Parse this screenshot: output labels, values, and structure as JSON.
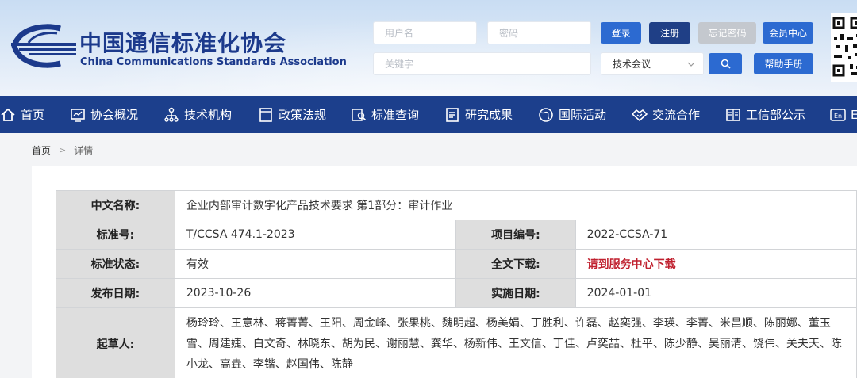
{
  "header": {
    "org_name_cn": "中国通信标准化协会",
    "org_name_en": "China Communications Standards Association",
    "username_placeholder": "用户名",
    "password_placeholder": "密码",
    "keyword_placeholder": "关键字",
    "login_label": "登录",
    "register_label": "注册",
    "forgot_label": "忘记密码",
    "member_center_label": "会员中心",
    "search_category": "技术会议",
    "help_label": "帮助手册"
  },
  "nav": {
    "items": [
      "首页",
      "协会概况",
      "技术机构",
      "政策法规",
      "标准查询",
      "研究成果",
      "国际活动",
      "交流合作",
      "工信部公示",
      "En"
    ]
  },
  "breadcrumb": {
    "home": "首页",
    "current": "详情"
  },
  "detail": {
    "cn_name_label": "中文名称:",
    "cn_name": "企业内部审计数字化产品技术要求 第1部分：审计作业",
    "std_no_label": "标准号:",
    "std_no": "T/CCSA 474.1-2023",
    "project_no_label": "项目编号:",
    "project_no": "2022-CCSA-71",
    "status_label": "标准状态:",
    "status": "有效",
    "download_label": "全文下载:",
    "download_link": "请到服务中心下载",
    "publish_label": "发布日期:",
    "publish_date": "2023-10-26",
    "impl_label": "实施日期:",
    "impl_date": "2024-01-01",
    "drafters_label": "起草人:",
    "drafters": "杨玲玲、王意林、蒋菁菁、王阳、周金峰、张果桃、魏明超、杨美娟、丁胜利、许磊、赵奕强、李瑛、李菁、米昌顺、陈丽娜、董玉雪、周建婕、白文奇、林晓东、胡为民、谢丽慧、龚华、杨新伟、王文信、丁佳、卢奕喆、杜平、陈少静、吴丽清、饶伟、关夫天、陈小龙、高垚、李锴、赵国伟、陈静"
  },
  "colors": {
    "nav_bg": "#1c3f8c",
    "button_blue": "#2c6ad1",
    "label_bg": "#dedede",
    "link_red": "#c0212f"
  }
}
